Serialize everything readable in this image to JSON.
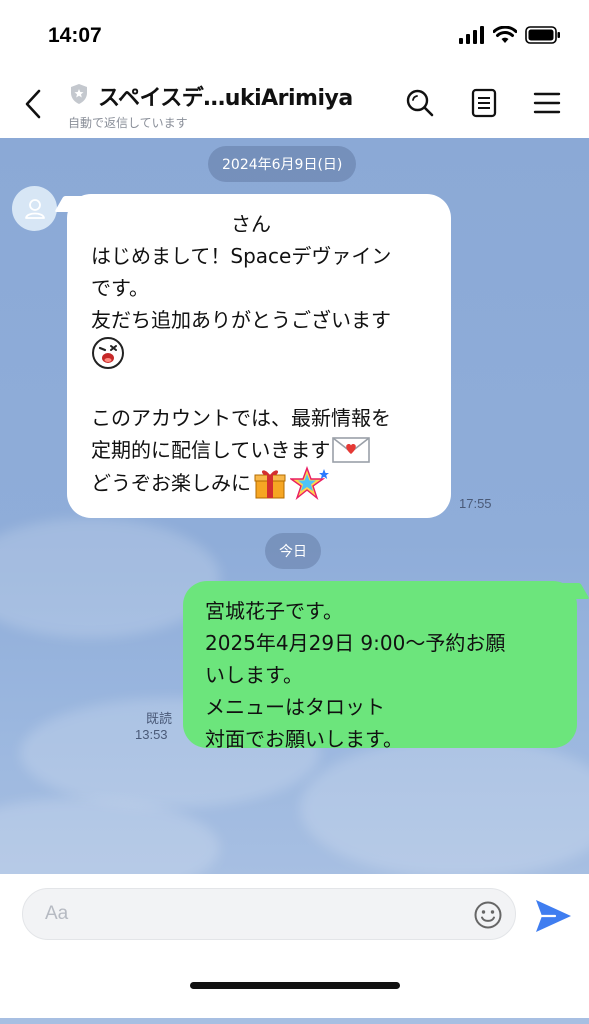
{
  "status_bar": {
    "time": "14:07"
  },
  "header": {
    "title": "スペイスデ…ukiArimiya",
    "subtitle": "自動で返信しています"
  },
  "chat": {
    "date_divider_1": "2024年6月9日(日)",
    "date_divider_2": "今日",
    "incoming": {
      "lines": [
        "　　　　　　　さん",
        "はじめまして！Spaceデヴァイン",
        "です。",
        "友だち追加ありがとうございます",
        "",
        "",
        "このアカウントでは、最新情報を",
        "定期的に配信していきます",
        "どうぞお楽しみに"
      ],
      "time": "17:55"
    },
    "outgoing": {
      "lines": [
        "宮城花子です。",
        "2025年4月29日 9:00～予約お願",
        "いします。",
        "メニューはタロット",
        "対面でお願いします。"
      ],
      "read_label": "既読",
      "time": "13:53"
    }
  },
  "input": {
    "placeholder": "Aa"
  },
  "colors": {
    "chat_bg": "#8ba9d6",
    "outgoing_bubble": "#6ce57c",
    "send_icon": "#3f7df0"
  }
}
